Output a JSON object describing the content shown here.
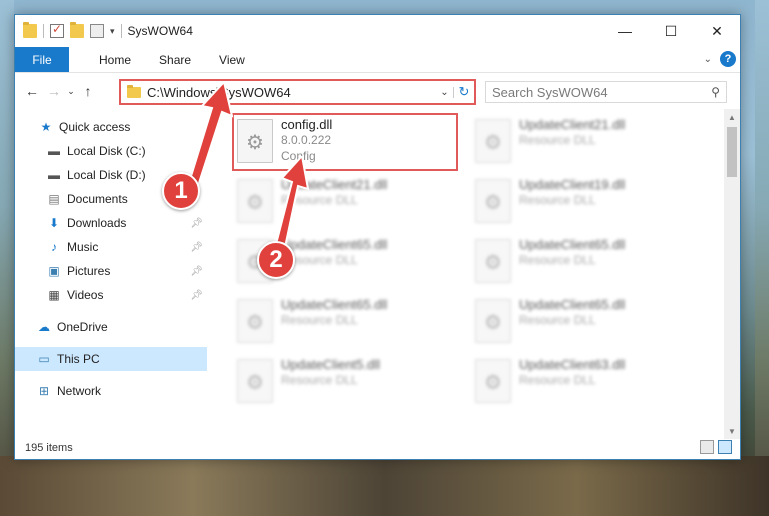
{
  "window": {
    "title": "SysWOW64",
    "controls": {
      "minimize": "—",
      "maximize": "☐",
      "close": "✕"
    }
  },
  "ribbon": {
    "tabs": [
      "File",
      "Home",
      "Share",
      "View"
    ]
  },
  "navbar": {
    "address": "C:\\Windows\\SysWOW64",
    "search_placeholder": "Search SysWOW64"
  },
  "sidebar": {
    "items": [
      {
        "label": "Quick access",
        "icon": "star-icon"
      },
      {
        "label": "Local Disk (C:)",
        "icon": "drive-icon"
      },
      {
        "label": "Local Disk (D:)",
        "icon": "drive-icon"
      },
      {
        "label": "Documents",
        "icon": "documents-icon"
      },
      {
        "label": "Downloads",
        "icon": "download-icon"
      },
      {
        "label": "Music",
        "icon": "music-icon"
      },
      {
        "label": "Pictures",
        "icon": "pictures-icon"
      },
      {
        "label": "Videos",
        "icon": "videos-icon"
      },
      {
        "label": "OneDrive",
        "icon": "cloud-icon"
      },
      {
        "label": "This PC",
        "icon": "computer-icon"
      },
      {
        "label": "Network",
        "icon": "network-icon"
      }
    ]
  },
  "files": [
    {
      "name": "config.dll",
      "line2": "8.0.0.222",
      "line3": "Config"
    },
    {
      "name": "UpdateClient21.dll",
      "line2": "Resource DLL"
    },
    {
      "name": "UpdateClient21.dll",
      "line2": "Resource DLL"
    },
    {
      "name": "UpdateClient19.dll",
      "line2": "Resource DLL"
    },
    {
      "name": "UpdateClient65.dll",
      "line2": "Resource DLL"
    },
    {
      "name": "UpdateClient65.dll",
      "line2": "Resource DLL"
    },
    {
      "name": "UpdateClient65.dll",
      "line2": "Resource DLL"
    },
    {
      "name": "UpdateClient65.dll",
      "line2": "Resource DLL"
    },
    {
      "name": "UpdateClient5.dll",
      "line2": "Resource DLL"
    },
    {
      "name": "UpdateClient63.dll",
      "line2": "Resource DLL"
    }
  ],
  "status": {
    "count": "195 items"
  },
  "annotations": {
    "step1": "1",
    "step2": "2"
  },
  "colors": {
    "accent": "#1979ca",
    "highlight": "#e05a5a",
    "selected": "#cce8ff"
  }
}
